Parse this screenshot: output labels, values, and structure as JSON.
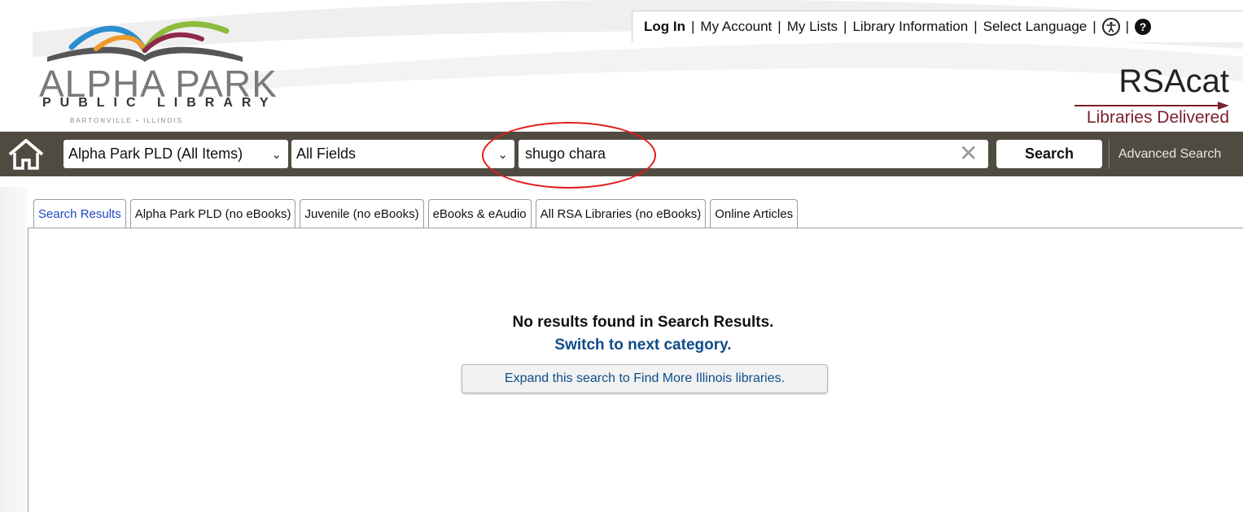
{
  "header": {
    "logo": {
      "name": "ALPHA PARK",
      "subtitle": "PUBLIC LIBRARY",
      "location": "BARTONVILLE • ILLINOIS"
    },
    "top_links": {
      "login": "Log In",
      "my_account": "My Account",
      "my_lists": "My Lists",
      "library_information": "Library Information",
      "select_language": "Select Language",
      "separator": "|"
    },
    "brand": {
      "title": "RSAcat",
      "tagline": "Libraries Delivered"
    }
  },
  "search": {
    "scope_selected": "Alpha Park PLD (All Items)",
    "field_selected": "All Fields",
    "query": "shugo chara",
    "submit_label": "Search",
    "advanced_label": "Advanced Search"
  },
  "tabs": [
    {
      "label": "Search Results",
      "active": true
    },
    {
      "label": "Alpha Park PLD (no eBooks)",
      "active": false
    },
    {
      "label": "Juvenile (no eBooks)",
      "active": false
    },
    {
      "label": "eBooks & eAudio",
      "active": false
    },
    {
      "label": "All RSA Libraries (no eBooks)",
      "active": false
    },
    {
      "label": "Online Articles",
      "active": false
    }
  ],
  "results": {
    "message": "No results found in Search Results.",
    "switch_link": "Switch to next category.",
    "expand_button": "Expand this search to Find More Illinois libraries."
  },
  "colors": {
    "search_bar_bg": "#4f4b41",
    "brand_accent": "#7b1f2b",
    "link_blue": "#0f4c8a",
    "active_tab": "#1f45c6",
    "annotation_circle": "#e11b1b"
  },
  "icons": [
    "home-icon",
    "chevron-down-icon",
    "clear-icon",
    "accessibility-icon",
    "help-icon"
  ]
}
